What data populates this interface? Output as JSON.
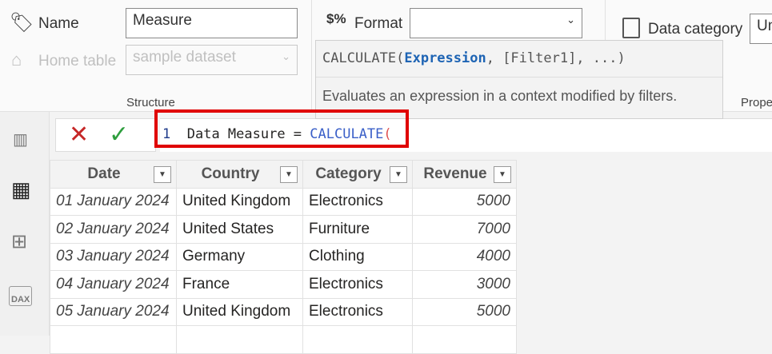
{
  "structure": {
    "name_label": "Name",
    "name_value": "Measure",
    "home_table_label": "Home table",
    "home_table_value": "sample dataset",
    "group_label": "Structure"
  },
  "formatting": {
    "format_label": "Format",
    "format_value": ""
  },
  "properties": {
    "data_category_label": "Data category",
    "data_category_value": "Un",
    "group_label": "Prope"
  },
  "tooltip": {
    "fn": "CALCULATE(",
    "param": "Expression",
    "rest": ", [Filter1], ...)",
    "description": "Evaluates an expression in a context modified by filters."
  },
  "formula": {
    "line_number": "1",
    "text": "Data Measure = ",
    "fn": "CALCULATE",
    "paren": "("
  },
  "table": {
    "columns": [
      "Date",
      "Country",
      "Category",
      "Revenue"
    ],
    "rows": [
      [
        "01 January 2024",
        "United Kingdom",
        "Electronics",
        "5000"
      ],
      [
        "02 January 2024",
        "United States",
        "Furniture",
        "7000"
      ],
      [
        "03 January 2024",
        "Germany",
        "Clothing",
        "4000"
      ],
      [
        "04 January 2024",
        "France",
        "Electronics",
        "3000"
      ],
      [
        "05 January 2024",
        "United Kingdom",
        "Electronics",
        "5000"
      ]
    ]
  },
  "colors": {
    "highlight": "#e00000",
    "keyword": "#3a5fc8",
    "cancel": "#c62828",
    "commit": "#2e9e3e"
  }
}
